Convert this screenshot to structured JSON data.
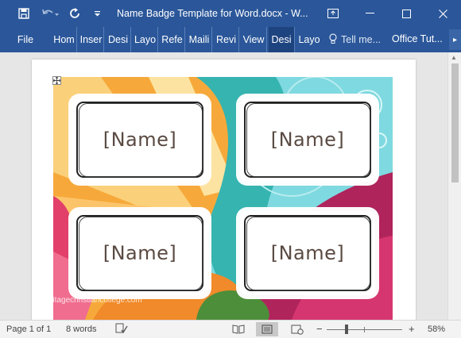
{
  "window": {
    "title": "Name Badge Template for Word.docx - W..."
  },
  "quick_access": {
    "save_icon": "save-icon",
    "undo_icon": "undo-icon",
    "redo_icon": "redo-icon",
    "customize_icon": "customize-quick-access-icon"
  },
  "window_controls": {
    "ribbon_display_icon": "ribbon-display-options-icon",
    "minimize_icon": "minimize-icon",
    "maximize_icon": "maximize-icon",
    "close_icon": "close-icon"
  },
  "ribbon": {
    "tabs": [
      {
        "label": "File"
      },
      {
        "label": "Hom"
      },
      {
        "label": "Inser"
      },
      {
        "label": "Desi"
      },
      {
        "label": "Layo"
      },
      {
        "label": "Refe"
      },
      {
        "label": "Maili"
      },
      {
        "label": "Revi"
      },
      {
        "label": "View"
      },
      {
        "label": "Desi"
      },
      {
        "label": "Layo"
      }
    ],
    "tell_me": "Tell me...",
    "account": "Office Tut...",
    "more_glyph": "▸"
  },
  "document": {
    "badges": [
      {
        "name": "[Name]"
      },
      {
        "name": "[Name]"
      },
      {
        "name": "[Name]"
      },
      {
        "name": "[Name]"
      }
    ],
    "watermark": "neritagechristiancollege.com"
  },
  "status_bar": {
    "page": "Page 1 of 1",
    "words": "8 words",
    "zoom_minus": "−",
    "zoom_plus": "+",
    "zoom": "58%",
    "zoom_fraction": 0.24
  },
  "colors": {
    "title_bar": "#2b579a",
    "badge_text": "#5a4a42"
  }
}
